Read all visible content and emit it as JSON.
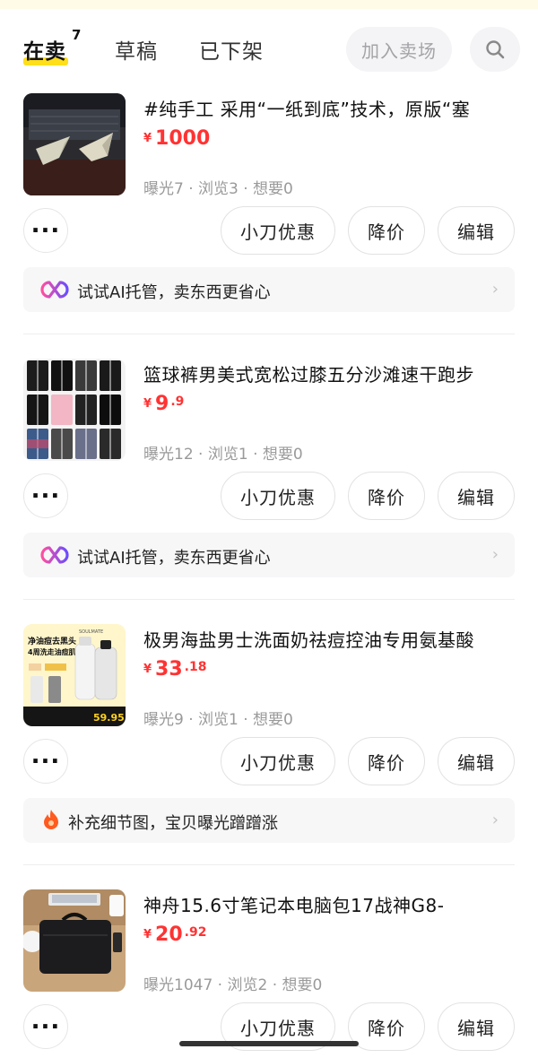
{
  "tabs": {
    "on_sale": "在卖",
    "on_sale_count": "7",
    "drafts": "草稿",
    "delisted": "已下架"
  },
  "join_market": "加入卖场",
  "icons": {
    "search": "search-icon",
    "more": "more-dots-icon",
    "ai": "ai-loop-icon",
    "fire": "fire-icon",
    "chevron": "chevron-right-icon"
  },
  "colors": {
    "accent_yellow": "#ffde1a",
    "price_red": "#ff3333",
    "ai_purple": "#8a4dff"
  },
  "items": [
    {
      "title": "#纯手工 采用“一纸到底”技术，原版“塞",
      "price_int": "1000",
      "price_dec": "",
      "stats": "曝光7 · 浏览3 · 想要0",
      "actions": {
        "knife": "小刀优惠",
        "reduce": "降价",
        "edit": "编辑"
      },
      "tip": "试试AI托管，卖东西更省心"
    },
    {
      "title": "篮球裤男美式宽松过膝五分沙滩速干跑步",
      "price_int": "9",
      "price_dec": ".9",
      "stats": "曝光12 · 浏览1 · 想要0",
      "actions": {
        "knife": "小刀优惠",
        "reduce": "降价",
        "edit": "编辑"
      },
      "tip": "试试AI托管，卖东西更省心"
    },
    {
      "title": "极男海盐男士洗面奶祛痘控油专用氨基酸",
      "price_int": "33",
      "price_dec": ".18",
      "stats": "曝光9 · 浏览1 · 想要0",
      "actions": {
        "knife": "小刀优惠",
        "reduce": "降价",
        "edit": "编辑"
      },
      "tip": "补充细节图，宝贝曝光蹭蹭涨",
      "thumb_text": {
        "headline": "净油痘去黑头",
        "subline": "4周洗走油痘肌",
        "brand": "SOULMATE",
        "price": "59.95"
      }
    },
    {
      "title": "神舟15.6寸笔记本电脑包17战神G8-",
      "price_int": "20",
      "price_dec": ".92",
      "stats": "曝光1047 · 浏览2 · 想要0",
      "actions": {
        "knife": "小刀优惠",
        "reduce": "降价",
        "edit": "编辑"
      }
    }
  ],
  "yen": "¥"
}
